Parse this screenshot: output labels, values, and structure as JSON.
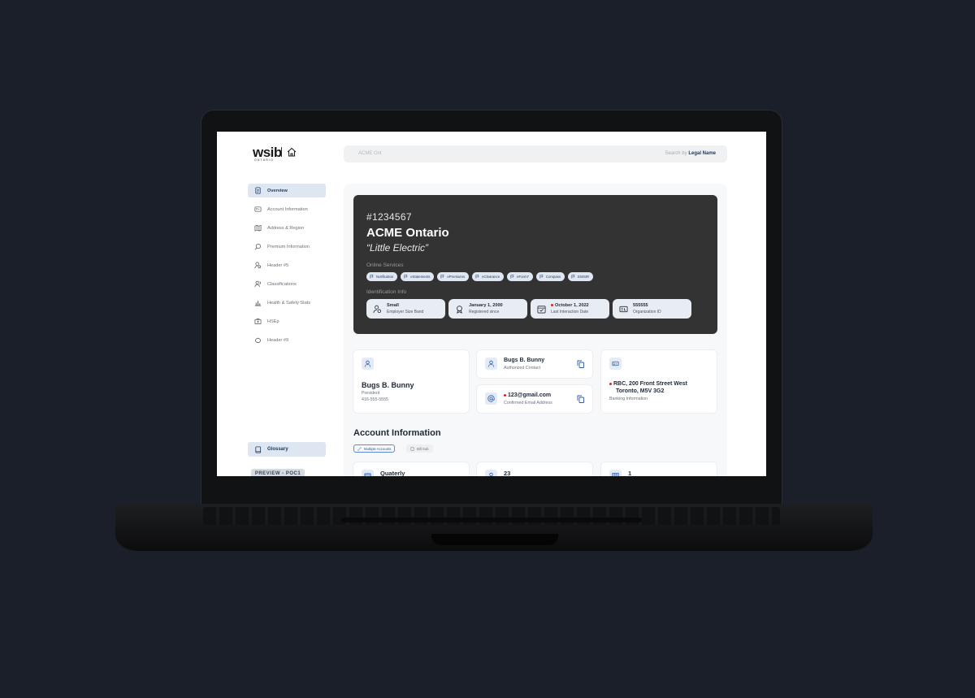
{
  "logo": {
    "brand": "wsib",
    "sub": "ONTARIO"
  },
  "search": {
    "value": "ACME Ont",
    "hint_prefix": "Search by",
    "hint_field": "Legal Name"
  },
  "sidebar": {
    "items": [
      {
        "label": "Overview",
        "icon": "document-icon"
      },
      {
        "label": "Account Information",
        "icon": "id-card-icon"
      },
      {
        "label": "Address & Region",
        "icon": "map-icon"
      },
      {
        "label": "Premium Information",
        "icon": "search-dollar-icon"
      },
      {
        "label": "Header #5",
        "icon": "user-settings-icon"
      },
      {
        "label": "Classifications",
        "icon": "users-icon"
      },
      {
        "label": "Health & Safety Stats",
        "icon": "chart-icon"
      },
      {
        "label": "HSEp",
        "icon": "first-aid-icon"
      },
      {
        "label": "Header #9",
        "icon": "piggy-bank-icon"
      }
    ],
    "glossary": "Glossary",
    "preview": "PREVIEW - POC1"
  },
  "hero": {
    "account_number": "#1234567",
    "name": "ACME Ontario",
    "alias": "“Little Electric”",
    "services_label": "Online Services",
    "services": [
      "Notification",
      "eStatements",
      "ePremiums",
      "eClearance",
      "eForm7",
      "Compass",
      "EWSIR"
    ],
    "ident_label": "Identification Info",
    "ident": [
      {
        "value": "Small",
        "label": "Employer Size Band",
        "alert": false
      },
      {
        "value": "January 1, 2000",
        "label": "Registered since",
        "alert": false
      },
      {
        "value": "October 1, 2022",
        "label": "Last Interaction Date",
        "alert": true
      },
      {
        "value": "555555",
        "label": "Organization ID",
        "alert": false
      }
    ]
  },
  "contact": {
    "name": "Bugs B. Bunny",
    "role": "President",
    "phone": "416-555-5555"
  },
  "authorized": {
    "name": "Bugs B. Bunny",
    "label": "Authorized Contact"
  },
  "email": {
    "value": "123@gmail.com",
    "label": "Confirmed Email Address"
  },
  "banking": {
    "line1": "RBC, 200 Front Street West",
    "line2": "Toronto, M5V 3G2",
    "label": "Banking Information"
  },
  "account_info": {
    "title": "Account Information",
    "badge_primary": "Multiple Accounts",
    "badge_secondary": "Bill Sub",
    "cards": [
      "Quaterly",
      "23",
      "1"
    ]
  },
  "colors": {
    "accent": "#1f3b63",
    "hero_bg": "#333333",
    "alert": "#dd2222"
  }
}
